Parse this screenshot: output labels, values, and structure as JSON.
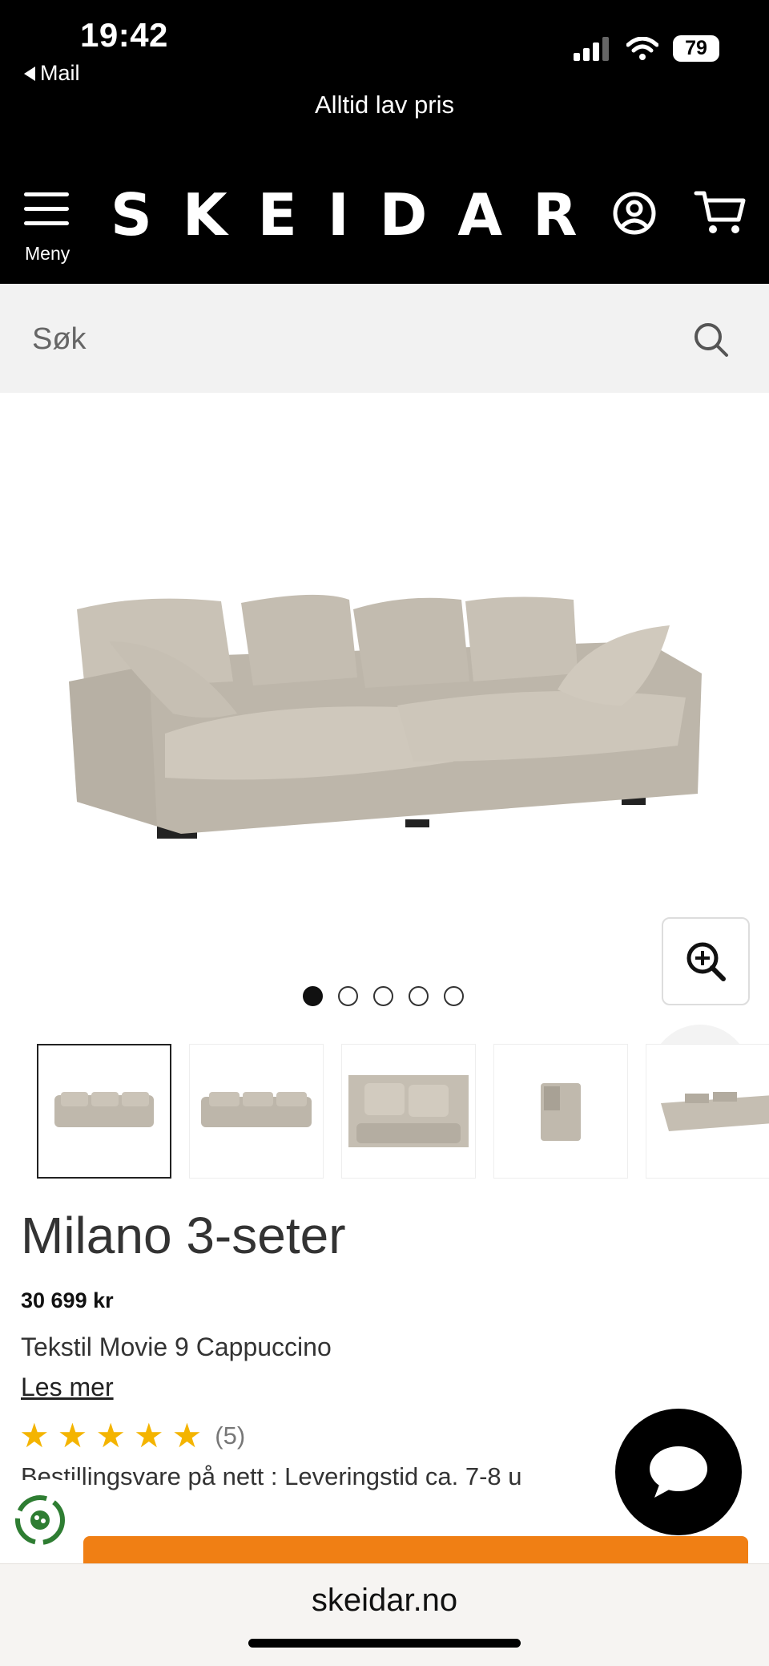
{
  "status_bar": {
    "time": "19:42",
    "back_app": "Mail",
    "battery": "79"
  },
  "promo_banner": "Alltid lav pris",
  "header": {
    "logo": "SKEIDAR",
    "menu_label": "Meny"
  },
  "search": {
    "placeholder": "Søk"
  },
  "gallery": {
    "dot_count": 5,
    "active_index": 0,
    "thumbnail_count": 5
  },
  "product": {
    "title": "Milano 3-seter",
    "price": "30 699 kr",
    "variant": "Tekstil Movie 9 Cappuccino",
    "read_more": "Les mer",
    "rating": 5,
    "review_count": "(5)",
    "delivery": "Bestillingsvare på nett : Leveringstid ca. 7-8 u"
  },
  "browser": {
    "url": "skeidar.no"
  },
  "colors": {
    "accent_orange": "#f07f14",
    "star": "#f4b400",
    "header_bg": "#000000"
  }
}
